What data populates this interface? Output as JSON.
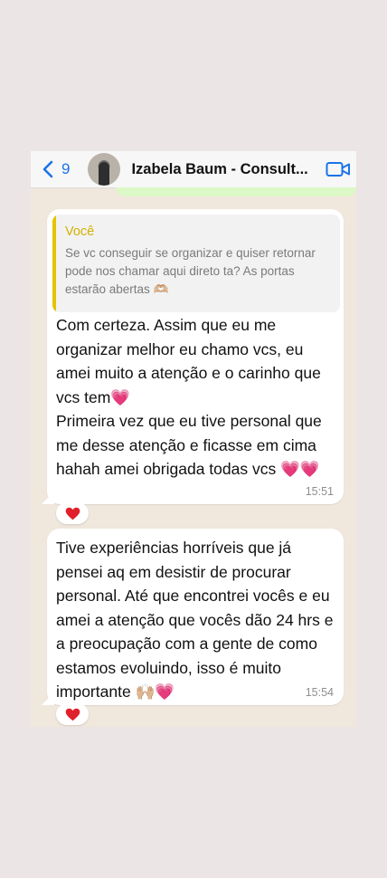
{
  "header": {
    "back_count": "9",
    "contact_name": "Izabela Baum - Consult...",
    "back_icon": "chevron-left-icon",
    "video_icon": "video-camera-icon"
  },
  "messages": [
    {
      "reply": {
        "author": "Você",
        "text": "Se vc conseguir se organizar e quiser retornar pode nos chamar aqui direto ta? As portas estarão abertas 🫶🏼"
      },
      "text": "Com certeza. Assim que eu me organizar melhor eu chamo vcs, eu amei muito a atenção e o carinho que vcs tem💗\nPrimeira vez que eu tive personal que me desse atenção e ficasse em cima hahah amei obrigada todas vcs 💗💗",
      "time": "15:51",
      "reaction": "❤️"
    },
    {
      "text": "Tive experiências horríveis que já pensei aq em desistir de procurar personal. Até que encontrei vocês e eu amei a atenção que vocês dão 24 hrs e a preocupação com a gente de como estamos evoluindo, isso é muito importante 🙌🏼💗",
      "time": "15:54",
      "reaction": "❤️"
    }
  ],
  "colors": {
    "accent": "#1a73e8",
    "quote_bar": "#e6c200",
    "outgoing_bubble": "#dcf8c6",
    "chat_background": "#f0e7dd",
    "heart": "#e0202a"
  }
}
